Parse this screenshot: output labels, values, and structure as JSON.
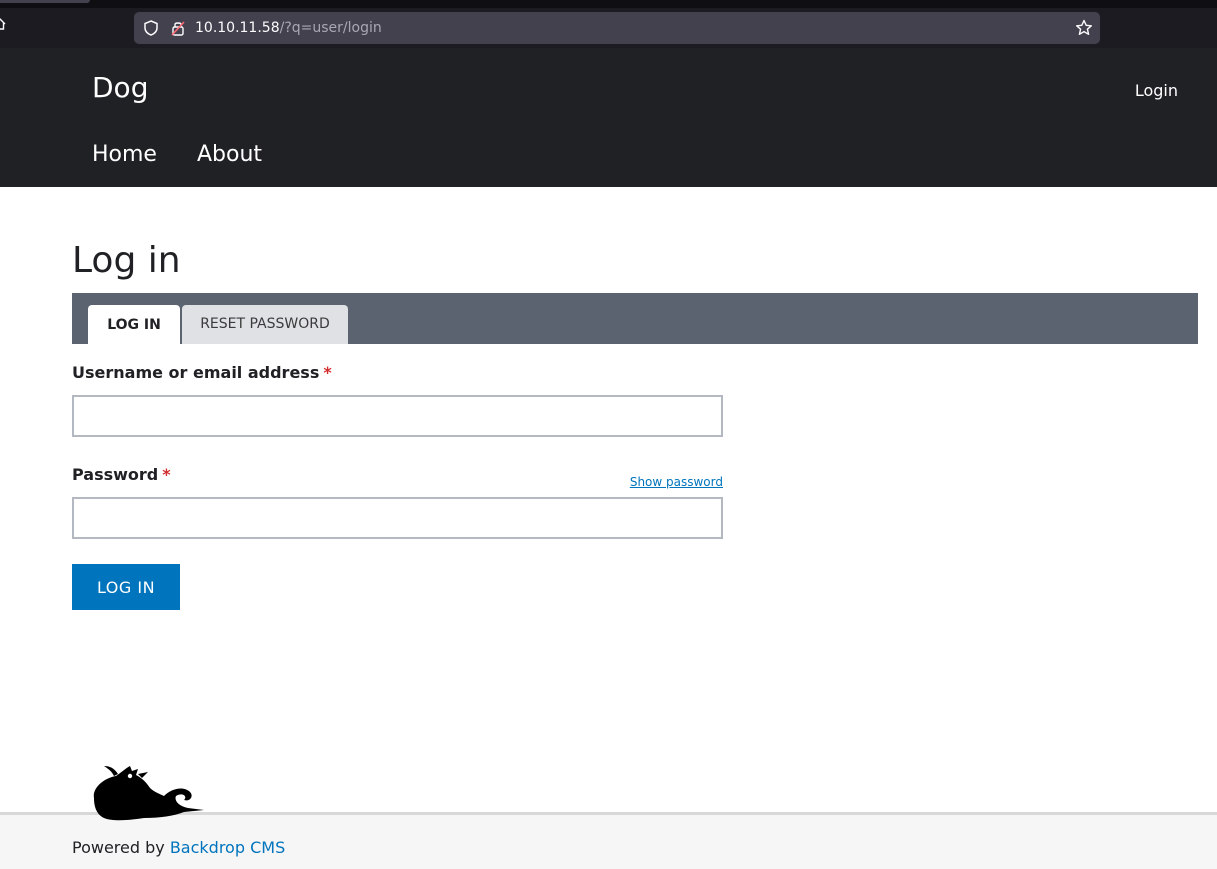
{
  "browser": {
    "url_host": "10.10.11.58",
    "url_path": "/?q=user/login",
    "home_icon": "home-icon",
    "shield_icon": "shield-icon",
    "lock_icon": "insecure-lock-icon",
    "star_icon": "bookmark-star-icon"
  },
  "header": {
    "site_name": "Dog",
    "login_link": "Login",
    "nav": [
      {
        "label": "Home"
      },
      {
        "label": "About"
      }
    ]
  },
  "page": {
    "title": "Log in"
  },
  "tabs": [
    {
      "label": "Log in",
      "active": true
    },
    {
      "label": "Reset password",
      "active": false
    }
  ],
  "form": {
    "username_label": "Username or email address",
    "username_value": "",
    "password_label": "Password",
    "password_value": "",
    "required_marker": "*",
    "show_password": "Show password",
    "submit_label": "Log in"
  },
  "footer": {
    "powered_by": "Powered by",
    "cms_link": "Backdrop CMS",
    "mascot_icon": "backdrop-dragon-logo"
  },
  "colors": {
    "header_bg": "#202125",
    "tabs_bg": "#5b6370",
    "primary_button": "#0074bd",
    "required": "#d22e2e"
  }
}
